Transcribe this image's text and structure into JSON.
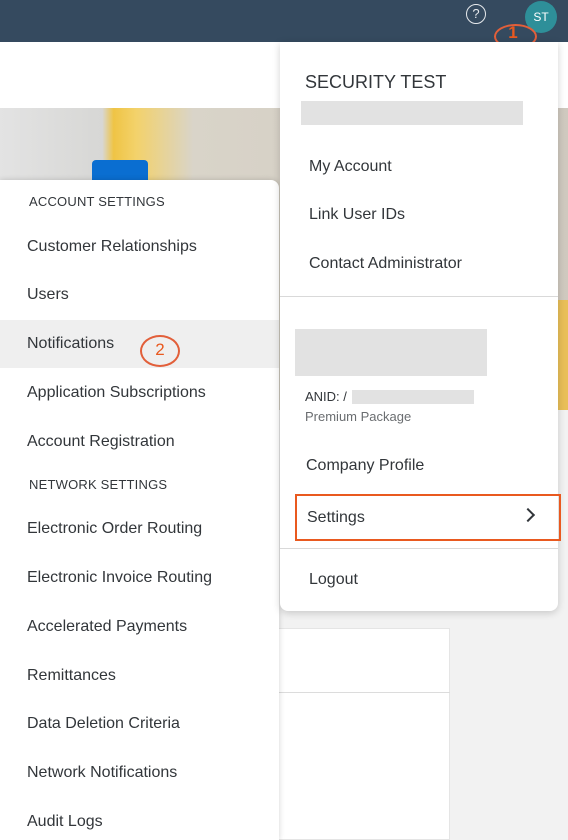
{
  "shell": {
    "help_glyph": "?",
    "avatar_initials": "ST",
    "callout_1": "1"
  },
  "account_settings_menu": {
    "section_account": "ACCOUNT SETTINGS",
    "account_items": [
      "Customer Relationships",
      "Users",
      "Notifications",
      "Application Subscriptions",
      "Account Registration"
    ],
    "section_network": "NETWORK SETTINGS",
    "network_items": [
      "Electronic Order Routing",
      "Electronic Invoice Routing",
      "Accelerated Payments",
      "Remittances",
      "Data Deletion Criteria",
      "Network Notifications",
      "Audit Logs"
    ],
    "active_item": "Notifications",
    "callout_2": "2"
  },
  "user_menu": {
    "user_name": "SECURITY TEST",
    "items": [
      "My Account",
      "Link User IDs",
      "Contact Administrator"
    ],
    "anid_label": "ANID: /",
    "package": "Premium Package",
    "company_profile": "Company Profile",
    "settings": "Settings",
    "logout": "Logout"
  },
  "colors": {
    "shell": "#354a5f",
    "avatar": "#2e8f99",
    "highlight": "#e9591f"
  }
}
